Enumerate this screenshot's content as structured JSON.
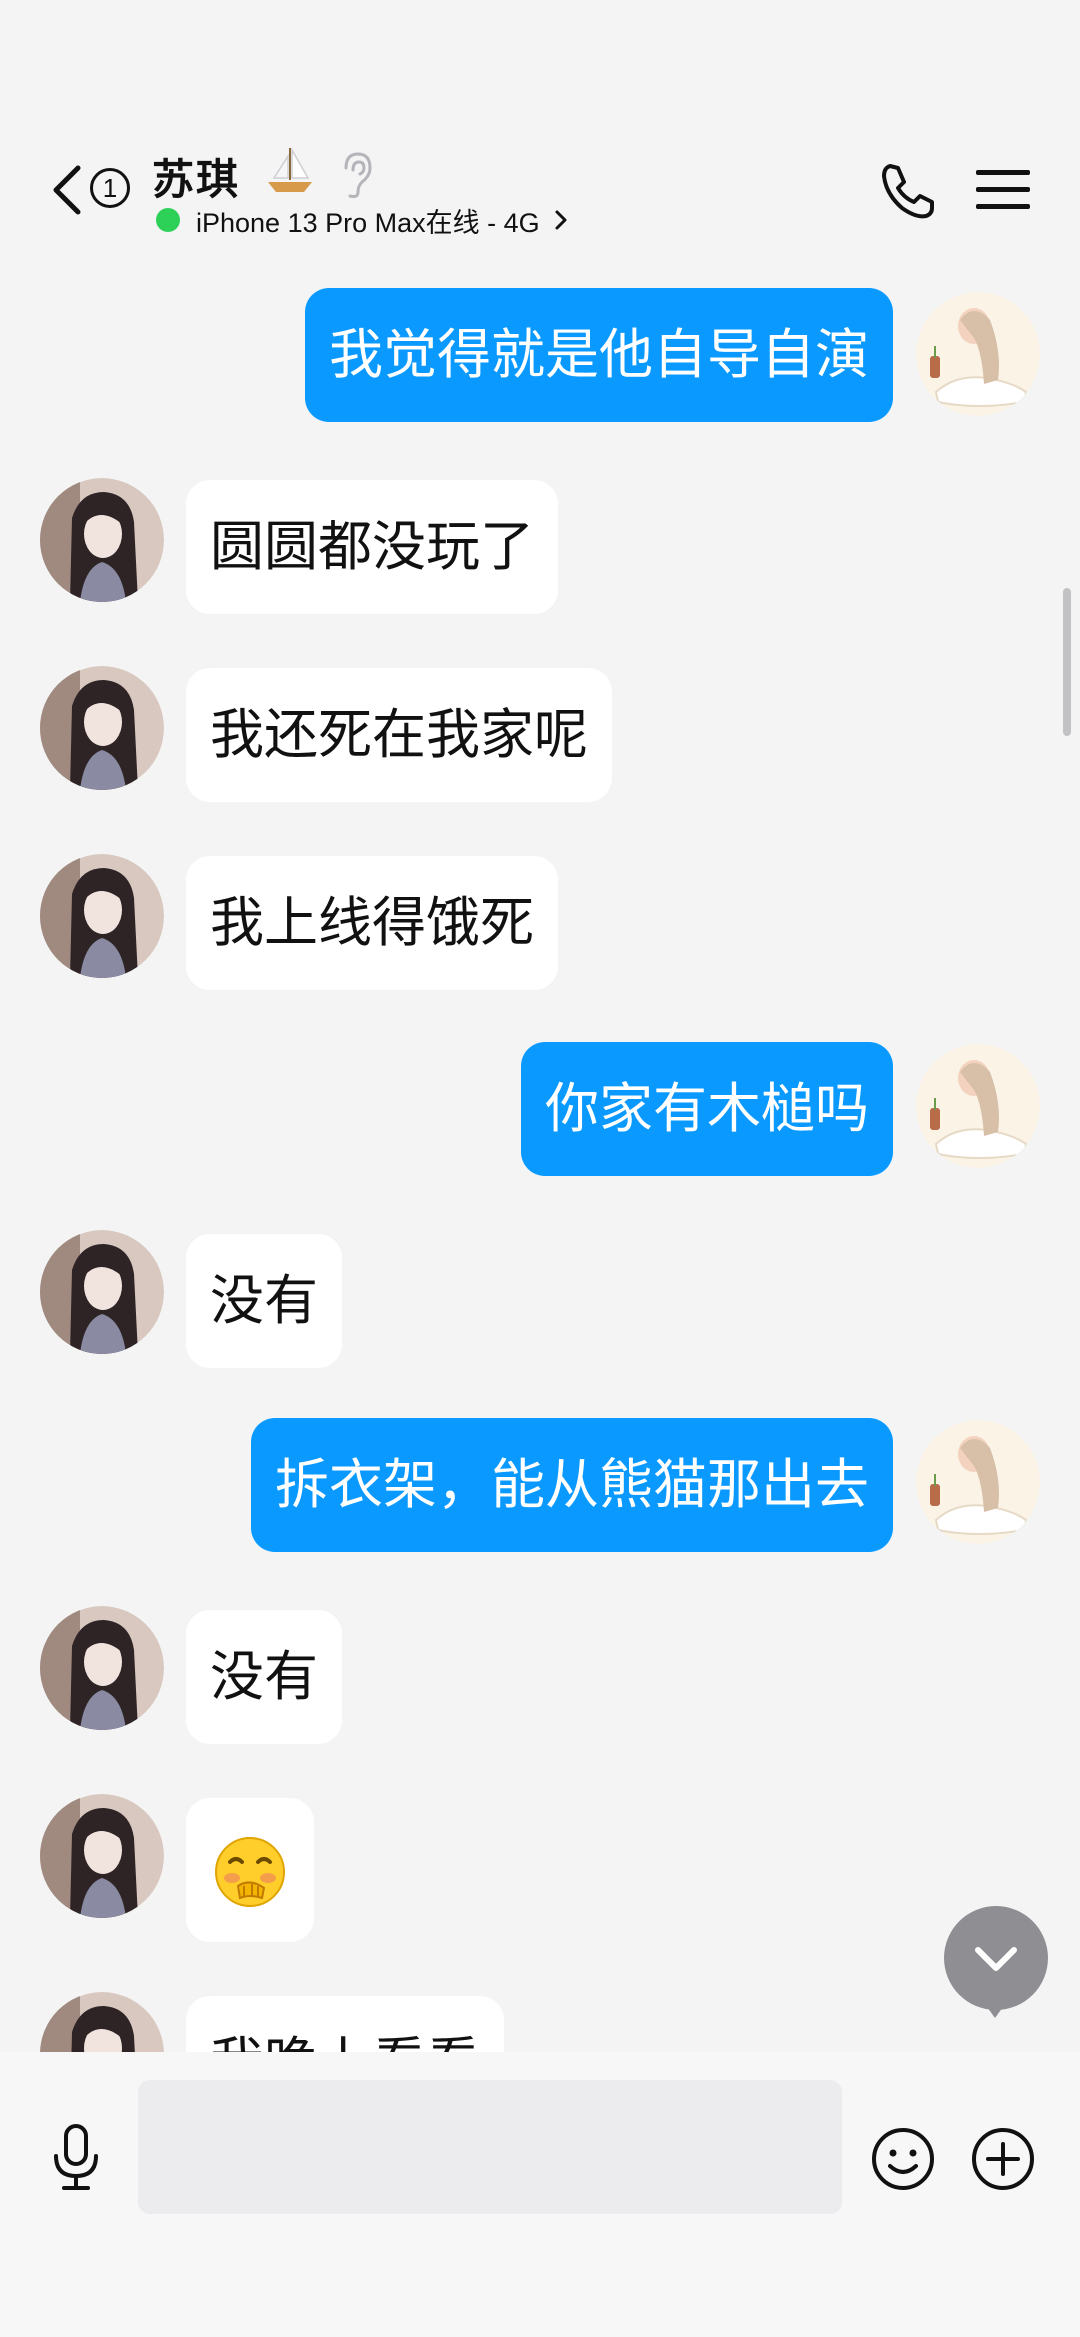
{
  "header": {
    "unread_count": "1",
    "contact_name": "苏琪",
    "status": "iPhone 13 Pro Max在线 - 4G"
  },
  "messages": [
    {
      "side": "out",
      "text": "我觉得就是他自导自演"
    },
    {
      "side": "in",
      "text": "圆圆都没玩了"
    },
    {
      "side": "in",
      "text": "我还死在我家呢"
    },
    {
      "side": "in",
      "text": "我上线得饿死"
    },
    {
      "side": "out",
      "text": "你家有木槌吗"
    },
    {
      "side": "in",
      "text": "没有"
    },
    {
      "side": "out",
      "text": "拆衣架，能从熊猫那出去"
    },
    {
      "side": "in",
      "text": "没有"
    },
    {
      "side": "in",
      "text": "",
      "sticker": "shy-covering-mouth-emoji"
    },
    {
      "side": "in",
      "text": "我晚上看看"
    }
  ],
  "input": {
    "placeholder": ""
  },
  "colors": {
    "outgoing_bubble": "#0a99ff",
    "incoming_bubble": "#ffffff",
    "online_dot": "#2ed158",
    "background": "#f4f4f5"
  }
}
